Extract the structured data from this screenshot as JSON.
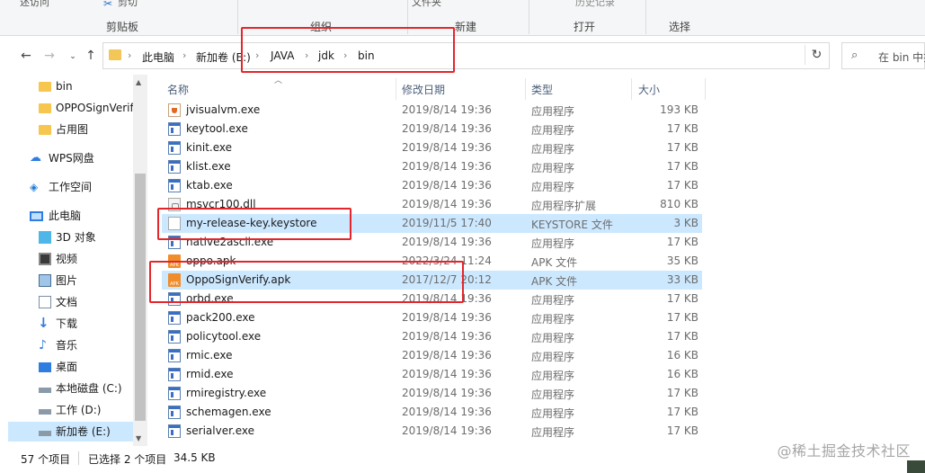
{
  "ribbon": {
    "top_partial_left": "述访问",
    "top_partial_copy": "剪切",
    "top_partial_file": "文件夹",
    "top_partial_history": "历史记录",
    "groups": [
      "剪贴板",
      "组织",
      "新建",
      "打开",
      "选择"
    ]
  },
  "address": {
    "crumbs": [
      "此电脑",
      "新加卷 (E:)",
      "JAVA",
      "jdk",
      "bin"
    ],
    "search_placeholder": "在 bin 中搜"
  },
  "nav": {
    "items": [
      {
        "label": "bin",
        "icon": "folder-icon"
      },
      {
        "label": "OPPOSignVerif",
        "icon": "folder-icon"
      },
      {
        "label": "占用图",
        "icon": "folder-icon"
      },
      {
        "label": "WPS网盘",
        "icon": "cloud-icon"
      },
      {
        "label": "工作空间",
        "icon": "workspace-icon"
      },
      {
        "label": "此电脑",
        "icon": "computer-icon"
      },
      {
        "label": "3D 对象",
        "icon": "cube-icon"
      },
      {
        "label": "视频",
        "icon": "video-icon"
      },
      {
        "label": "图片",
        "icon": "picture-icon"
      },
      {
        "label": "文档",
        "icon": "document-icon"
      },
      {
        "label": "下载",
        "icon": "download-icon"
      },
      {
        "label": "音乐",
        "icon": "music-icon"
      },
      {
        "label": "桌面",
        "icon": "desktop-icon"
      },
      {
        "label": "本地磁盘 (C:)",
        "icon": "drive-icon"
      },
      {
        "label": "工作 (D:)",
        "icon": "drive-icon"
      },
      {
        "label": "新加卷 (E:)",
        "icon": "drive-icon"
      }
    ]
  },
  "columns": {
    "name": "名称",
    "date": "修改日期",
    "type": "类型",
    "size": "大小"
  },
  "files": [
    {
      "name": "jvisualvm.exe",
      "date": "2019/8/14 19:36",
      "type": "应用程序",
      "size": "193 KB",
      "icon": "cup"
    },
    {
      "name": "keytool.exe",
      "date": "2019/8/14 19:36",
      "type": "应用程序",
      "size": "17 KB",
      "icon": "exe"
    },
    {
      "name": "kinit.exe",
      "date": "2019/8/14 19:36",
      "type": "应用程序",
      "size": "17 KB",
      "icon": "exe"
    },
    {
      "name": "klist.exe",
      "date": "2019/8/14 19:36",
      "type": "应用程序",
      "size": "17 KB",
      "icon": "exe"
    },
    {
      "name": "ktab.exe",
      "date": "2019/8/14 19:36",
      "type": "应用程序",
      "size": "17 KB",
      "icon": "exe"
    },
    {
      "name": "msvcr100.dll",
      "date": "2019/8/14 19:36",
      "type": "应用程序扩展",
      "size": "810 KB",
      "icon": "dll"
    },
    {
      "name": "my-release-key.keystore",
      "date": "2019/11/5 17:40",
      "type": "KEYSTORE 文件",
      "size": "3 KB",
      "icon": "doc"
    },
    {
      "name": "native2ascii.exe",
      "date": "2019/8/14 19:36",
      "type": "应用程序",
      "size": "17 KB",
      "icon": "exe"
    },
    {
      "name": "oppo.apk",
      "date": "2022/3/24 11:24",
      "type": "APK 文件",
      "size": "35 KB",
      "icon": "apk"
    },
    {
      "name": "OppoSignVerify.apk",
      "date": "2017/12/7 20:12",
      "type": "APK 文件",
      "size": "33 KB",
      "icon": "apk"
    },
    {
      "name": "orbd.exe",
      "date": "2019/8/14 19:36",
      "type": "应用程序",
      "size": "17 KB",
      "icon": "exe"
    },
    {
      "name": "pack200.exe",
      "date": "2019/8/14 19:36",
      "type": "应用程序",
      "size": "17 KB",
      "icon": "exe"
    },
    {
      "name": "policytool.exe",
      "date": "2019/8/14 19:36",
      "type": "应用程序",
      "size": "17 KB",
      "icon": "exe"
    },
    {
      "name": "rmic.exe",
      "date": "2019/8/14 19:36",
      "type": "应用程序",
      "size": "16 KB",
      "icon": "exe"
    },
    {
      "name": "rmid.exe",
      "date": "2019/8/14 19:36",
      "type": "应用程序",
      "size": "16 KB",
      "icon": "exe"
    },
    {
      "name": "rmiregistry.exe",
      "date": "2019/8/14 19:36",
      "type": "应用程序",
      "size": "17 KB",
      "icon": "exe"
    },
    {
      "name": "schemagen.exe",
      "date": "2019/8/14 19:36",
      "type": "应用程序",
      "size": "17 KB",
      "icon": "exe"
    },
    {
      "name": "serialver.exe",
      "date": "2019/8/14 19:36",
      "type": "应用程序",
      "size": "17 KB",
      "icon": "exe"
    }
  ],
  "status": {
    "count": "57 个项目",
    "selected": "已选择 2 个项目",
    "size": "34.5 KB"
  },
  "watermark": "@稀土掘金技术社区",
  "colors": {
    "selection": "#cce8ff",
    "annotation": "#e3262b",
    "header_text": "#4c607a"
  }
}
